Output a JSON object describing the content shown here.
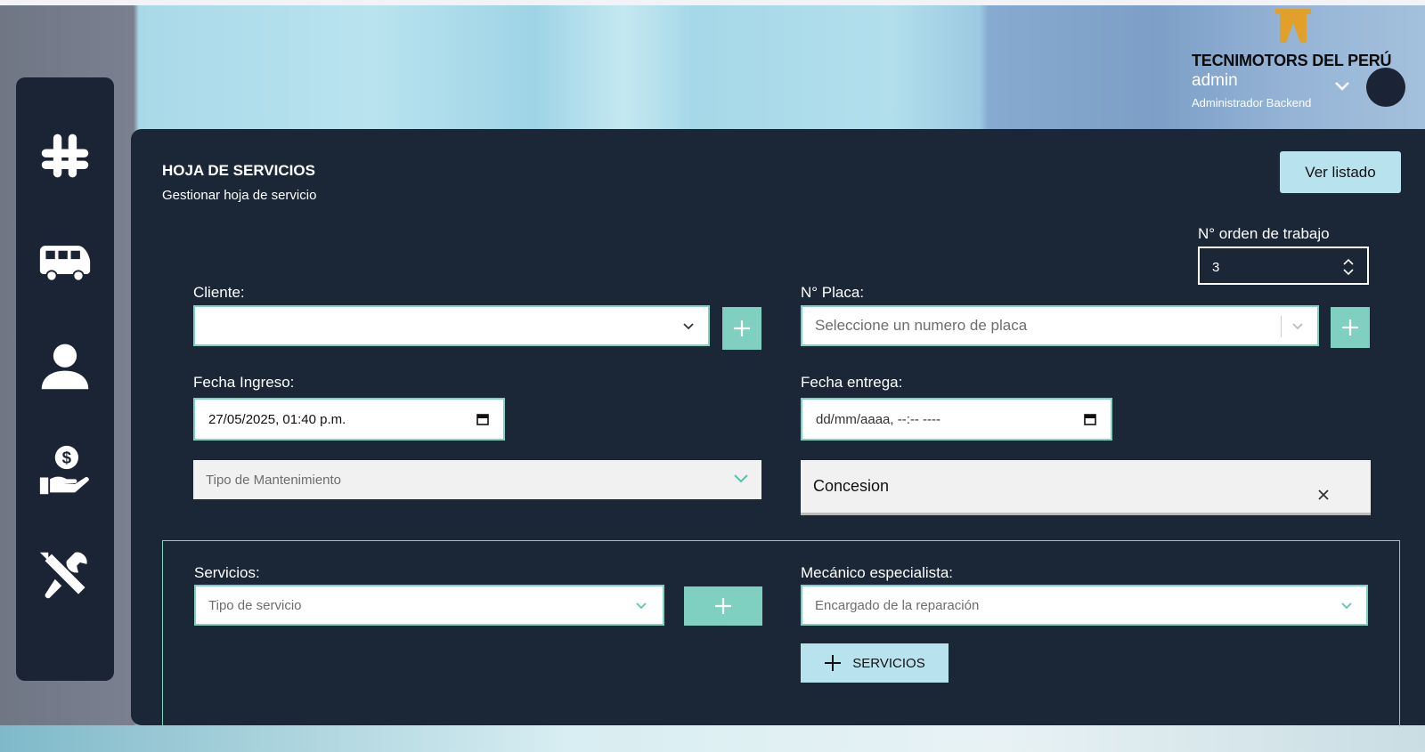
{
  "brand": {
    "name": "TECNIMOTORS DEL PERÚ",
    "logo_color": "#e1a02a"
  },
  "user": {
    "name": "admin",
    "role": "Administrador Backend"
  },
  "sidebar": {
    "items": [
      {
        "icon": "slack-hash-icon"
      },
      {
        "icon": "bus-icon"
      },
      {
        "icon": "user-icon"
      },
      {
        "icon": "hand-dollar-icon"
      },
      {
        "icon": "tools-icon"
      }
    ]
  },
  "page": {
    "title": "HOJA DE SERVICIOS",
    "subtitle": "Gestionar hoja de servicio",
    "list_button": "Ver listado"
  },
  "form": {
    "orden_label": "N° orden de trabajo",
    "orden_value": "3",
    "cliente_label": "Cliente:",
    "cliente_value": "",
    "placa_label": "N° Placa:",
    "placa_placeholder": "Seleccione un numero de placa",
    "fecha_ingreso_label": "Fecha Ingreso:",
    "fecha_ingreso_value": "27/05/2025, 01:40 p.m.",
    "fecha_entrega_label": "Fecha entrega:",
    "fecha_entrega_value": "dd/mm/aaaa, --:-- ----",
    "mantenimiento_placeholder": "Tipo de Mantenimiento",
    "concesion_value": "Concesion"
  },
  "services": {
    "servicios_label": "Servicios:",
    "servicio_placeholder": "Tipo de servicio",
    "mecanico_label": "Mecánico especialista:",
    "mecanico_placeholder": "Encargado de la reparación",
    "add_button": "SERVICIOS"
  },
  "colors": {
    "panel": "#1b2637",
    "accent": "#7fd0c0",
    "button": "#b8e2ee"
  }
}
